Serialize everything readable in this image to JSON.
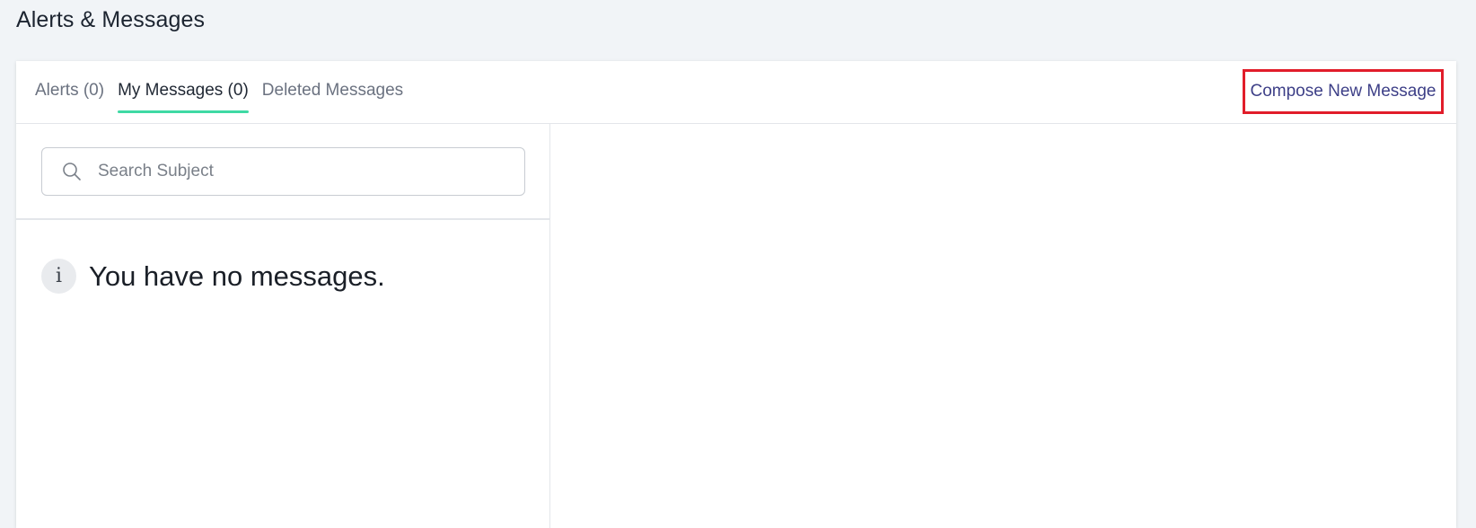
{
  "page": {
    "title": "Alerts & Messages"
  },
  "tabs": [
    {
      "label": "Alerts (0)",
      "active": false
    },
    {
      "label": "My Messages (0)",
      "active": true
    },
    {
      "label": "Deleted Messages",
      "active": false
    }
  ],
  "compose": {
    "label": "Compose New Message",
    "highlight_color": "#e11d2a",
    "link_color": "#3d3f87"
  },
  "search": {
    "placeholder": "Search Subject",
    "value": "",
    "icon": "search-icon"
  },
  "empty_state": {
    "icon": "info-icon",
    "icon_glyph": "i",
    "message": "You have no messages."
  },
  "colors": {
    "background": "#f1f4f7",
    "active_tab_underline": "#3fd9a4"
  }
}
